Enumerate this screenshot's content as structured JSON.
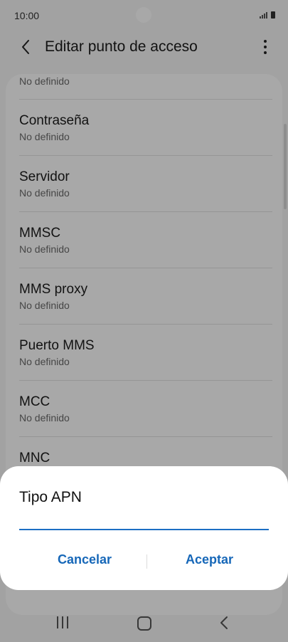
{
  "status_bar": {
    "time": "10:00"
  },
  "header": {
    "title": "Editar punto de acceso"
  },
  "list": {
    "items": [
      {
        "title": "",
        "subtitle": "No definido"
      },
      {
        "title": "Contraseña",
        "subtitle": "No definido"
      },
      {
        "title": "Servidor",
        "subtitle": "No definido"
      },
      {
        "title": "MMSC",
        "subtitle": "No definido"
      },
      {
        "title": "MMS proxy",
        "subtitle": "No definido"
      },
      {
        "title": "Puerto MMS",
        "subtitle": "No definido"
      },
      {
        "title": "MCC",
        "subtitle": "No definido"
      },
      {
        "title": "MNC",
        "subtitle": ""
      }
    ]
  },
  "dialog": {
    "title": "Tipo APN",
    "input_value": "",
    "cancel_label": "Cancelar",
    "accept_label": "Aceptar"
  },
  "colors": {
    "accent": "#1667b8",
    "underline": "#1c6fc4",
    "scrim": "rgba(0,0,0,0.34)"
  },
  "icons": {
    "back": "chevron-left-icon",
    "more": "more-vert-icon",
    "nav_recent": "recent-apps-icon",
    "nav_home": "home-icon",
    "nav_back": "nav-back-icon"
  }
}
